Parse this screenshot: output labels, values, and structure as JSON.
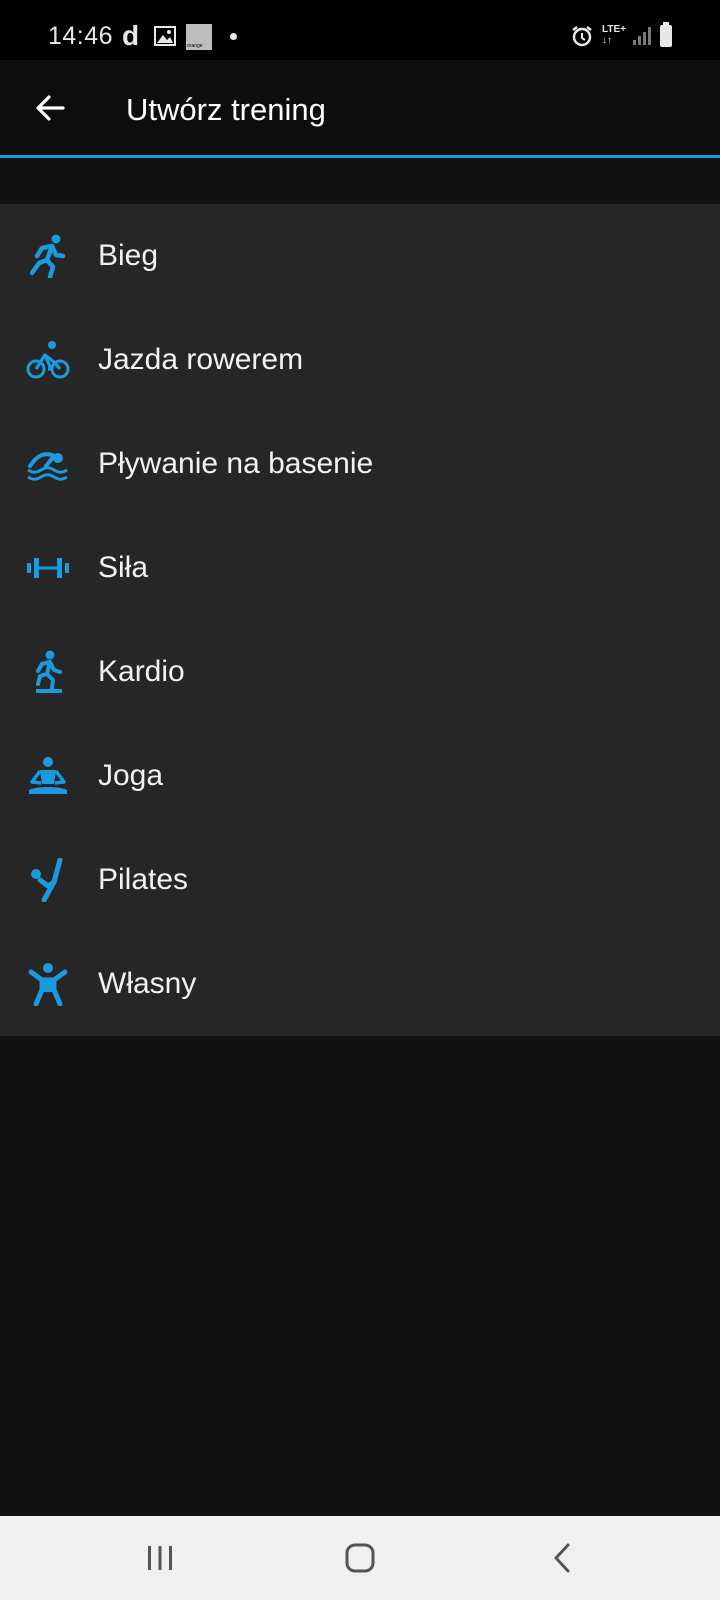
{
  "status_bar": {
    "time": "14:46",
    "carrier_glyph": "d",
    "orange_label": "orange",
    "network": "LTE+"
  },
  "app_bar": {
    "title": "Utwórz trening",
    "back_icon": "arrow-left-icon"
  },
  "accent_color": "#1a9be0",
  "items": [
    {
      "label": "Bieg",
      "icon": "running-icon"
    },
    {
      "label": "Jazda rowerem",
      "icon": "cycling-icon"
    },
    {
      "label": "Pływanie na basenie",
      "icon": "swimming-icon"
    },
    {
      "label": "Siła",
      "icon": "dumbbell-icon"
    },
    {
      "label": "Kardio",
      "icon": "stair-step-icon"
    },
    {
      "label": "Joga",
      "icon": "yoga-icon"
    },
    {
      "label": "Pilates",
      "icon": "pilates-icon"
    },
    {
      "label": "Własny",
      "icon": "custom-person-icon"
    }
  ],
  "nav_bar": {
    "recents_icon": "recents-icon",
    "home_icon": "home-icon",
    "back_icon": "back-chevron-icon"
  }
}
